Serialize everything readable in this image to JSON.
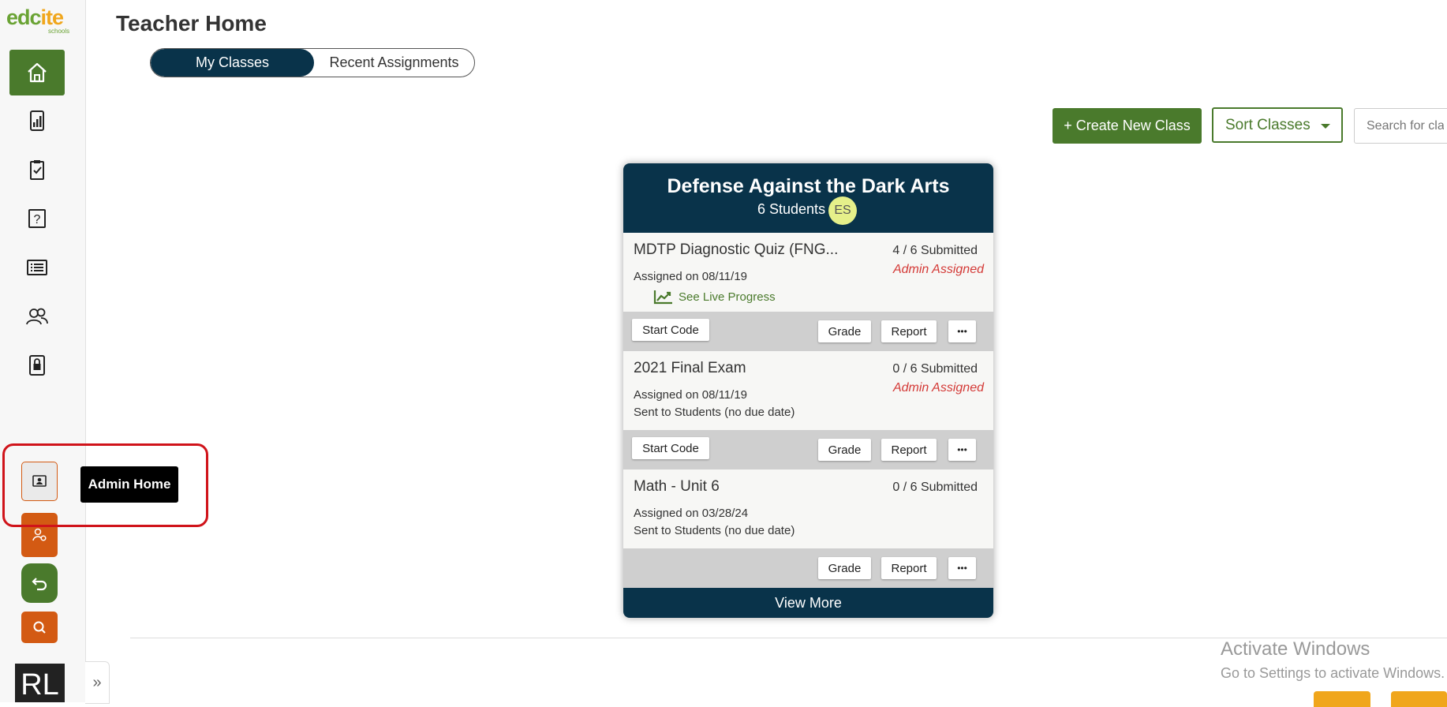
{
  "logo": {
    "word_a": "edc",
    "word_b": "ite",
    "sub": "schools"
  },
  "header": {
    "title": "Teacher Home"
  },
  "tabs": [
    {
      "label": "My Classes"
    },
    {
      "label": "Recent Assignments"
    }
  ],
  "toolbar": {
    "create_label": "+ Create New Class",
    "sort_label": "Sort Classes",
    "search_placeholder": "Search for class"
  },
  "sidebar": {
    "items": [
      {
        "name": "home-icon"
      },
      {
        "name": "reports-icon"
      },
      {
        "name": "assignments-icon"
      },
      {
        "name": "questions-icon"
      },
      {
        "name": "list-icon"
      },
      {
        "name": "students-icon"
      },
      {
        "name": "lock-icon"
      }
    ],
    "tooltip": "Admin Home",
    "avatar": "RL",
    "expand_glyph": "»"
  },
  "card": {
    "title": "Defense Against the Dark Arts",
    "students": "6 Students",
    "badge": "ES",
    "assignments": [
      {
        "title": "MDTP Diagnostic Quiz (FNG...",
        "submitted": "4 / 6 Submitted",
        "admin": "Admin Assigned",
        "date": "Assigned on 08/11/19",
        "live": "See Live Progress"
      },
      {
        "title": "2021 Final Exam",
        "submitted": "0 / 6 Submitted",
        "admin": "Admin Assigned",
        "date": "Assigned on 08/11/19",
        "sent": "Sent to Students (no due date)"
      },
      {
        "title": "Math - Unit 6",
        "submitted": "0 / 6 Submitted",
        "date": "Assigned on 03/28/24",
        "sent": "Sent to Students (no due date)"
      }
    ],
    "buttons": {
      "start_code": "Start Code",
      "grade": "Grade",
      "report": "Report",
      "more": "•••"
    },
    "view_more": "View More"
  },
  "watermark": {
    "line1": "Activate Windows",
    "line2": "Go to Settings to activate Windows."
  },
  "colors": {
    "navy": "#09334a",
    "green": "#4a7a2c",
    "orange": "#d35a13",
    "admin_red": "#d43a37",
    "highlight_red": "#d0131a"
  }
}
